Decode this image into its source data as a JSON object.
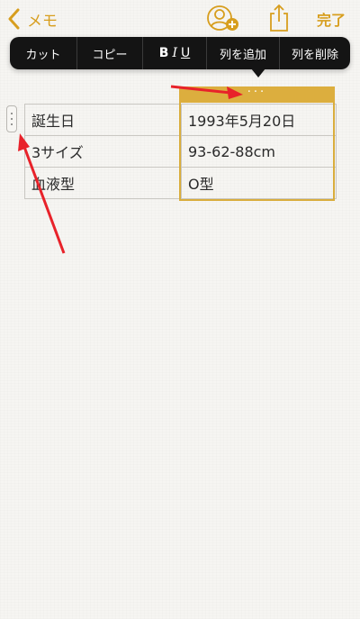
{
  "colors": {
    "accent": "#d79e1e",
    "menu_bg": "#141414",
    "column_highlight": "#dcae3e",
    "annotation_arrow": "#e8222a"
  },
  "nav": {
    "back_label": "メモ",
    "back_icon": "chevron-left-icon",
    "add_person_icon": "person-add-icon",
    "share_icon": "share-icon",
    "done_label": "完了"
  },
  "context_menu": {
    "cut": "カット",
    "copy": "コピー",
    "bold": "B",
    "italic": "I",
    "underline": "U",
    "add_column": "列を追加",
    "delete_column": "列を削除"
  },
  "column_handle": {
    "dots": "···"
  },
  "table": {
    "rows": [
      [
        "誕生日",
        "1993年5月20日"
      ],
      [
        "3サイズ",
        "93-62-88cm"
      ],
      [
        "血液型",
        "O型"
      ]
    ]
  }
}
